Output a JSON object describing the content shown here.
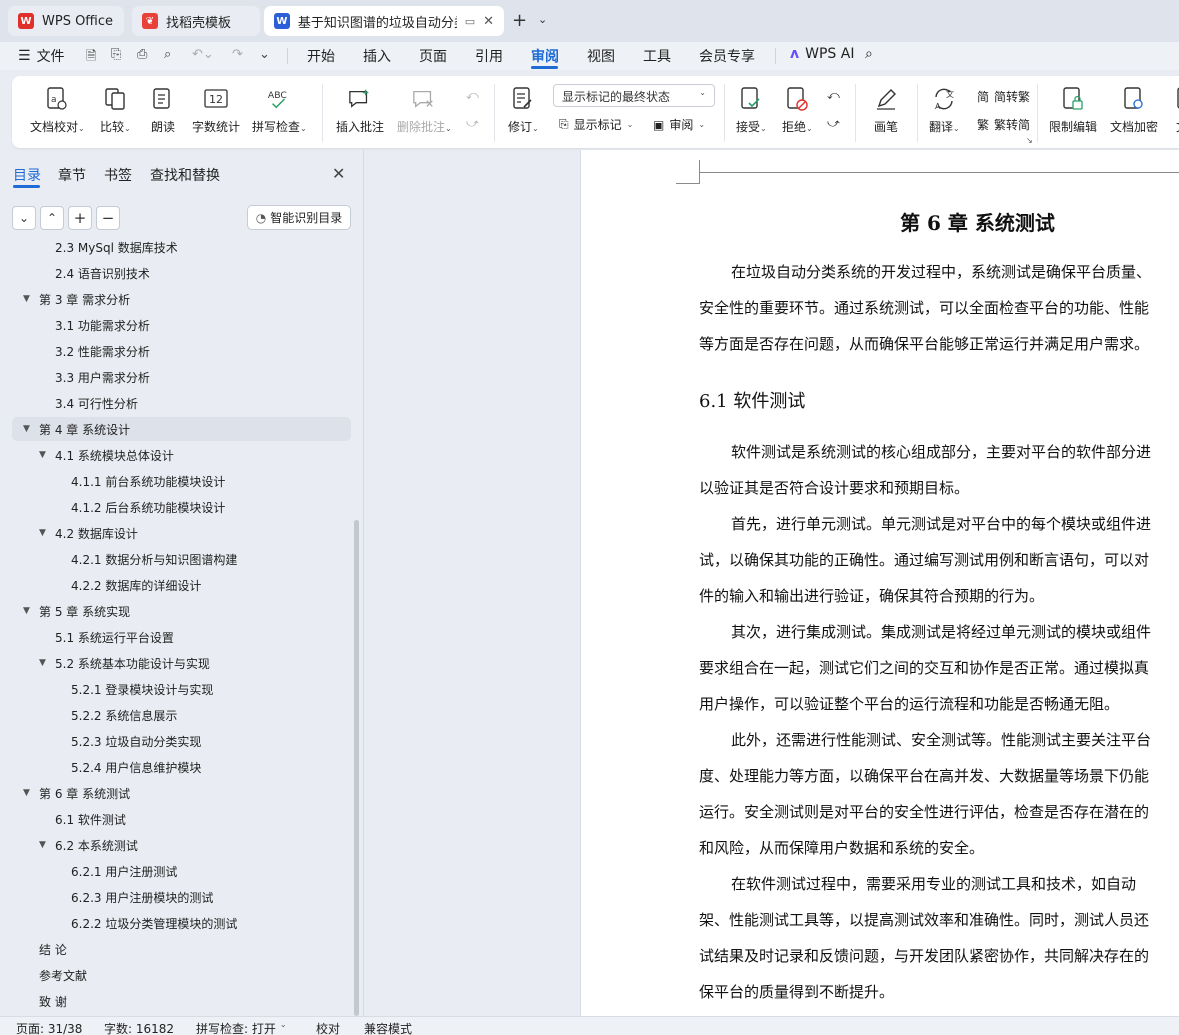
{
  "tabs": [
    {
      "label": "WPS Office",
      "icon": "wps-logo-icon",
      "color": "#e0302a"
    },
    {
      "label": "找稻壳模板",
      "icon": "docer-icon",
      "color": "#e8413a"
    },
    {
      "label": "基于知识图谱的垃圾自动分类",
      "icon": "word-doc-icon",
      "color": "#2b5fd9"
    }
  ],
  "menubar": {
    "file": "文件",
    "items": [
      "开始",
      "插入",
      "页面",
      "引用",
      "审阅",
      "视图",
      "工具",
      "会员专享"
    ],
    "active": "审阅",
    "wps_ai": "WPS AI"
  },
  "ribbon": {
    "doc_proof": "文档校对",
    "compare": "比较",
    "read_aloud": "朗读",
    "word_count": "字数统计",
    "spell_check": "拼写检查",
    "insert_comment": "插入批注",
    "delete_comment": "删除批注",
    "track_changes": "修订",
    "markup_state": "显示标记的最终状态",
    "show_markup": "显示标记",
    "review": "审阅",
    "accept": "接受",
    "reject": "拒绝",
    "pen": "画笔",
    "translate": "翻译",
    "to_traditional": "简转繁",
    "to_simplified": "繁转简",
    "restrict_edit": "限制编辑",
    "encrypt": "文档加密",
    "cut_label": "文",
    "icon_text_abc": "ABC",
    "icon_text_12": "12",
    "icon_text_jian": "简",
    "icon_text_fan": "繁"
  },
  "nav": {
    "tabs": [
      "目录",
      "章节",
      "书签",
      "查找和替换"
    ],
    "smart_toc": "智能识别目录",
    "toc": [
      {
        "label": "2.3 MySql 数据库技术",
        "level": 2,
        "arrow": ""
      },
      {
        "label": "2.4  语音识别技术",
        "level": 2,
        "arrow": ""
      },
      {
        "label": "第 3 章   需求分析",
        "level": 1,
        "arrow": "▼"
      },
      {
        "label": "3.1  功能需求分析",
        "level": 2,
        "arrow": ""
      },
      {
        "label": "3.2  性能需求分析",
        "level": 2,
        "arrow": ""
      },
      {
        "label": "3.3  用户需求分析",
        "level": 2,
        "arrow": ""
      },
      {
        "label": "3.4  可行性分析",
        "level": 2,
        "arrow": ""
      },
      {
        "label": "第 4 章  系统设计",
        "level": 1,
        "arrow": "▼",
        "selected": true
      },
      {
        "label": "4.1  系统模块总体设计",
        "level": 2,
        "arrow": "▼"
      },
      {
        "label": "4.1.1  前台系统功能模块设计",
        "level": 3,
        "arrow": ""
      },
      {
        "label": "4.1.2  后台系统功能模块设计",
        "level": 3,
        "arrow": ""
      },
      {
        "label": "4.2  数据库设计",
        "level": 2,
        "arrow": "▼"
      },
      {
        "label": "4.2.1  数据分析与知识图谱构建",
        "level": 3,
        "arrow": ""
      },
      {
        "label": "4.2.2  数据库的详细设计",
        "level": 3,
        "arrow": ""
      },
      {
        "label": "第 5 章  系统实现",
        "level": 1,
        "arrow": "▼"
      },
      {
        "label": "5.1  系统运行平台设置",
        "level": 2,
        "arrow": ""
      },
      {
        "label": "5.2 系统基本功能设计与实现",
        "level": 2,
        "arrow": "▼"
      },
      {
        "label": "5.2.1  登录模块设计与实现",
        "level": 3,
        "arrow": ""
      },
      {
        "label": "5.2.2  系统信息展示",
        "level": 3,
        "arrow": ""
      },
      {
        "label": "5.2.3  垃圾自动分类实现",
        "level": 3,
        "arrow": ""
      },
      {
        "label": "5.2.4  用户信息维护模块",
        "level": 3,
        "arrow": ""
      },
      {
        "label": "第 6 章  系统测试",
        "level": 1,
        "arrow": "▼"
      },
      {
        "label": "6.1  软件测试",
        "level": 2,
        "arrow": ""
      },
      {
        "label": "6.2  本系统测试",
        "level": 2,
        "arrow": "▼"
      },
      {
        "label": "6.2.1  用户注册测试",
        "level": 3,
        "arrow": ""
      },
      {
        "label": "6.2.3  用户注册模块的测试",
        "level": 3,
        "arrow": ""
      },
      {
        "label": "6.2.2  垃圾分类管理模块的测试",
        "level": 3,
        "arrow": ""
      },
      {
        "label": "结    论",
        "level": 1,
        "arrow": ""
      },
      {
        "label": "参考文献",
        "level": 1,
        "arrow": ""
      },
      {
        "label": "致    谢",
        "level": 1,
        "arrow": ""
      }
    ]
  },
  "document": {
    "chapter_title": "第 6 章  系统测试",
    "section_title": "6.1  软件测试",
    "lines": [
      {
        "text": "在垃圾自动分类系统的开发过程中，系统测试是确保平台质量、",
        "indent": true
      },
      {
        "text": "安全性的重要环节。通过系统测试，可以全面检查平台的功能、性能",
        "indent": false
      },
      {
        "text": "等方面是否存在问题，从而确保平台能够正常运行并满足用户需求。",
        "indent": false
      },
      {
        "text": "软件测试是系统测试的核心组成部分，主要对平台的软件部分进",
        "indent": true
      },
      {
        "text": "以验证其是否符合设计要求和预期目标。",
        "indent": false
      },
      {
        "text": "首先，进行单元测试。单元测试是对平台中的每个模块或组件进",
        "indent": true
      },
      {
        "text": "试，以确保其功能的正确性。通过编写测试用例和断言语句，可以对",
        "indent": false
      },
      {
        "text": "件的输入和输出进行验证，确保其符合预期的行为。",
        "indent": false
      },
      {
        "text": "其次，进行集成测试。集成测试是将经过单元测试的模块或组件",
        "indent": true
      },
      {
        "text": "要求组合在一起，测试它们之间的交互和协作是否正常。通过模拟真",
        "indent": false
      },
      {
        "text": "用户操作，可以验证整个平台的运行流程和功能是否畅通无阻。",
        "indent": false
      },
      {
        "text": "此外，还需进行性能测试、安全测试等。性能测试主要关注平台",
        "indent": true
      },
      {
        "text": "度、处理能力等方面，以确保平台在高并发、大数据量等场景下仍能",
        "indent": false
      },
      {
        "text": "运行。安全测试则是对平台的安全性进行评估，检查是否存在潜在的",
        "indent": false
      },
      {
        "text": "和风险，从而保障用户数据和系统的安全。",
        "indent": false
      },
      {
        "text": "在软件测试过程中，需要采用专业的测试工具和技术，如自动",
        "indent": true
      },
      {
        "text": "架、性能测试工具等，以提高测试效率和准确性。同时，测试人员还",
        "indent": false
      },
      {
        "text": "试结果及时记录和反馈问题，与开发团队紧密协作，共同解决存在的",
        "indent": false
      },
      {
        "text": "保平台的质量得到不断提升。",
        "indent": false
      }
    ]
  },
  "status": {
    "page": "页面: 31/38",
    "words": "字数: 16182",
    "spell": "拼写检查: 打开",
    "proof": "校对",
    "compat": "兼容模式"
  },
  "colors": {
    "accent": "#1e6bd6",
    "tab_bg": "#dfe4ec",
    "page_bg": "#ffffff"
  }
}
